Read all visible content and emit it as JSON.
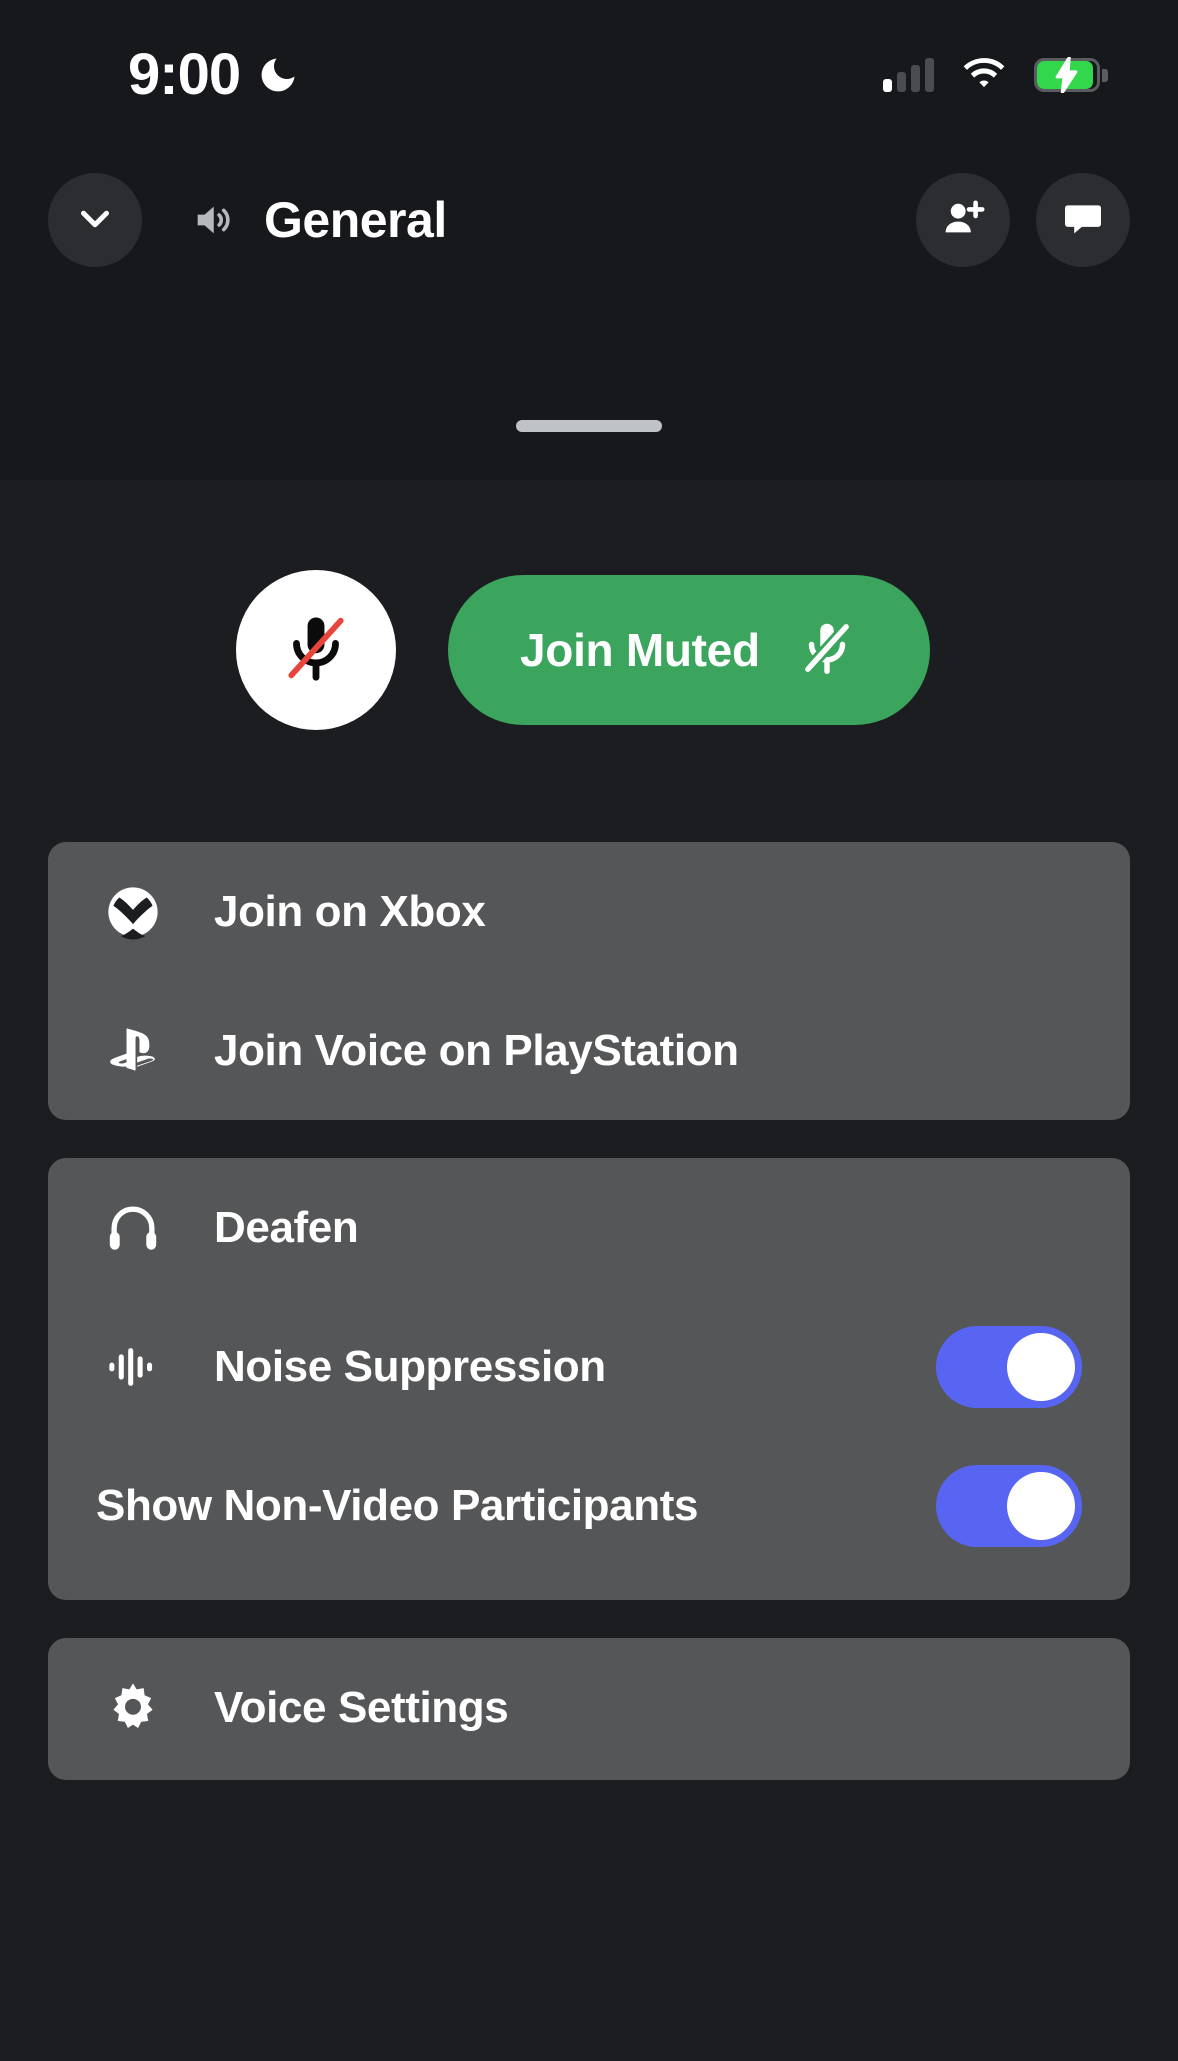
{
  "status_bar": {
    "time": "9:00",
    "dnd_icon": "crescent-moon-icon",
    "signal_icon": "cellular-signal-icon",
    "signal_bars_filled": 1,
    "signal_bars_total": 4,
    "wifi_icon": "wifi-icon",
    "battery_icon": "battery-charging-icon",
    "battery_color": "#32D74B"
  },
  "header": {
    "collapse_icon": "chevron-down-icon",
    "channel_icon": "speaker-volume-icon",
    "channel_name": "General",
    "add_member_icon": "person-add-icon",
    "chat_icon": "chat-bubble-icon"
  },
  "sheet": {
    "grabber": "drag-handle",
    "mute_toggle": {
      "icon": "microphone-muted-icon",
      "state": "muted",
      "slash_color": "#E8453C"
    },
    "join_button": {
      "label": "Join Muted",
      "icon": "microphone-muted-icon",
      "color": "#3BA55D"
    },
    "console_options": [
      {
        "icon": "xbox-icon",
        "label": "Join on Xbox"
      },
      {
        "icon": "playstation-icon",
        "label": "Join Voice on PlayStation"
      }
    ],
    "audio_options": [
      {
        "icon": "headphones-icon",
        "label": "Deafen",
        "has_toggle": false
      },
      {
        "icon": "waveform-icon",
        "label": "Noise Suppression",
        "has_toggle": true,
        "toggle_on": true
      },
      {
        "icon": null,
        "label": "Show Non-Video Participants",
        "has_toggle": true,
        "toggle_on": true
      }
    ],
    "settings_option": {
      "icon": "gear-icon",
      "label": "Voice Settings"
    },
    "toggle_on_color": "#5865F2",
    "card_color": "#555658"
  }
}
